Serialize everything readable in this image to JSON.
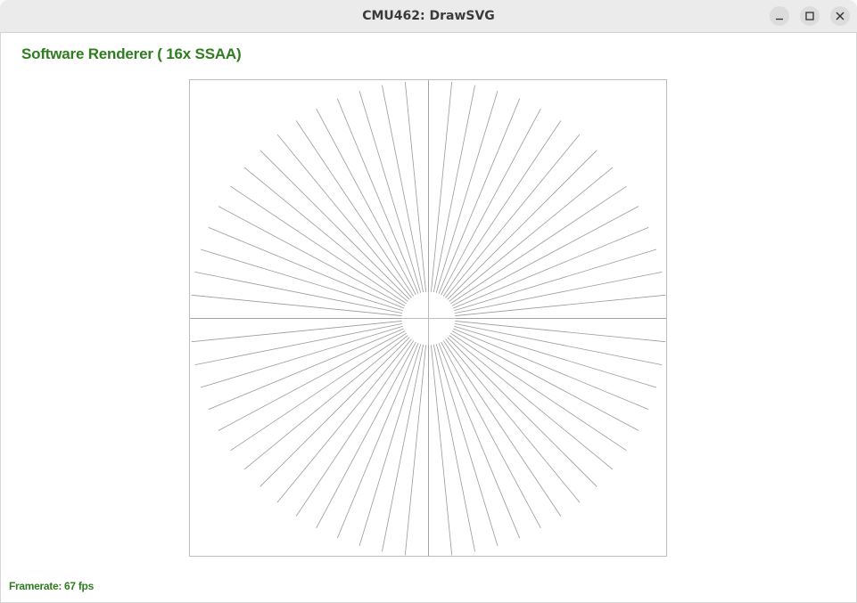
{
  "window": {
    "title": "CMU462: DrawSVG",
    "controls": {
      "minimize_icon": "minimize-icon",
      "maximize_icon": "maximize-icon",
      "close_icon": "close-icon"
    }
  },
  "renderer": {
    "label": "Software Renderer ( 16x SSAA)"
  },
  "status": {
    "framerate_text": "Framerate: 67 fps"
  },
  "scene": {
    "name": "radial line pattern",
    "line_count": 64,
    "line_color": "#9a9a9a",
    "frame_color": "#bdbdbd"
  },
  "colors": {
    "accent": "#2e7d1e",
    "titlebar": "#ebebeb"
  }
}
